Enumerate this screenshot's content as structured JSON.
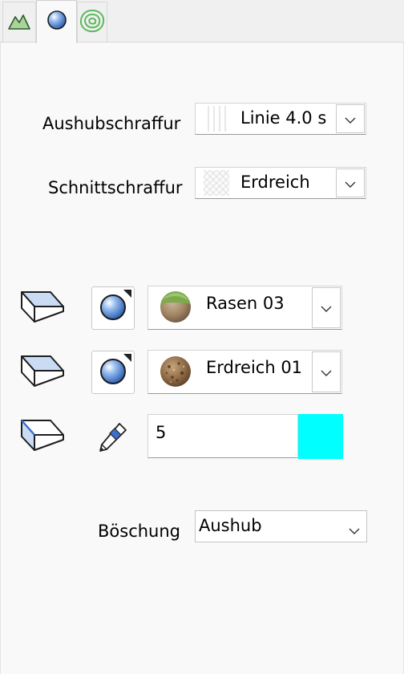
{
  "tabs": [
    {
      "icon": "terrain-mountain-icon",
      "active": false
    },
    {
      "icon": "material-sphere-icon",
      "active": true
    },
    {
      "icon": "contour-lines-icon",
      "active": false
    }
  ],
  "hatching": {
    "excavation_label": "Aushubschraffur",
    "excavation_value": "Linie 4.0 s",
    "section_label": "Schnittschraffur",
    "section_value": "Erdreich"
  },
  "surfaces": [
    {
      "solid_icon": "solid-top-face-icon",
      "button_icon": "material-sphere-icon",
      "swatch_icon": "grass-material-icon",
      "value": "Rasen 03"
    },
    {
      "solid_icon": "solid-top-face-icon",
      "button_icon": "material-sphere-icon",
      "swatch_icon": "soil-material-icon",
      "value": "Erdreich 01"
    },
    {
      "solid_icon": "solid-edge-icon",
      "button_icon": "pen-icon",
      "value": "5",
      "color": "#00ffff"
    }
  ],
  "slope": {
    "label": "Böschung",
    "value": "Aushub"
  },
  "colors": {
    "panel": "#f9f9f9",
    "accent_cyan": "#00ffff",
    "sphere_blue": "#4a7fd0"
  }
}
